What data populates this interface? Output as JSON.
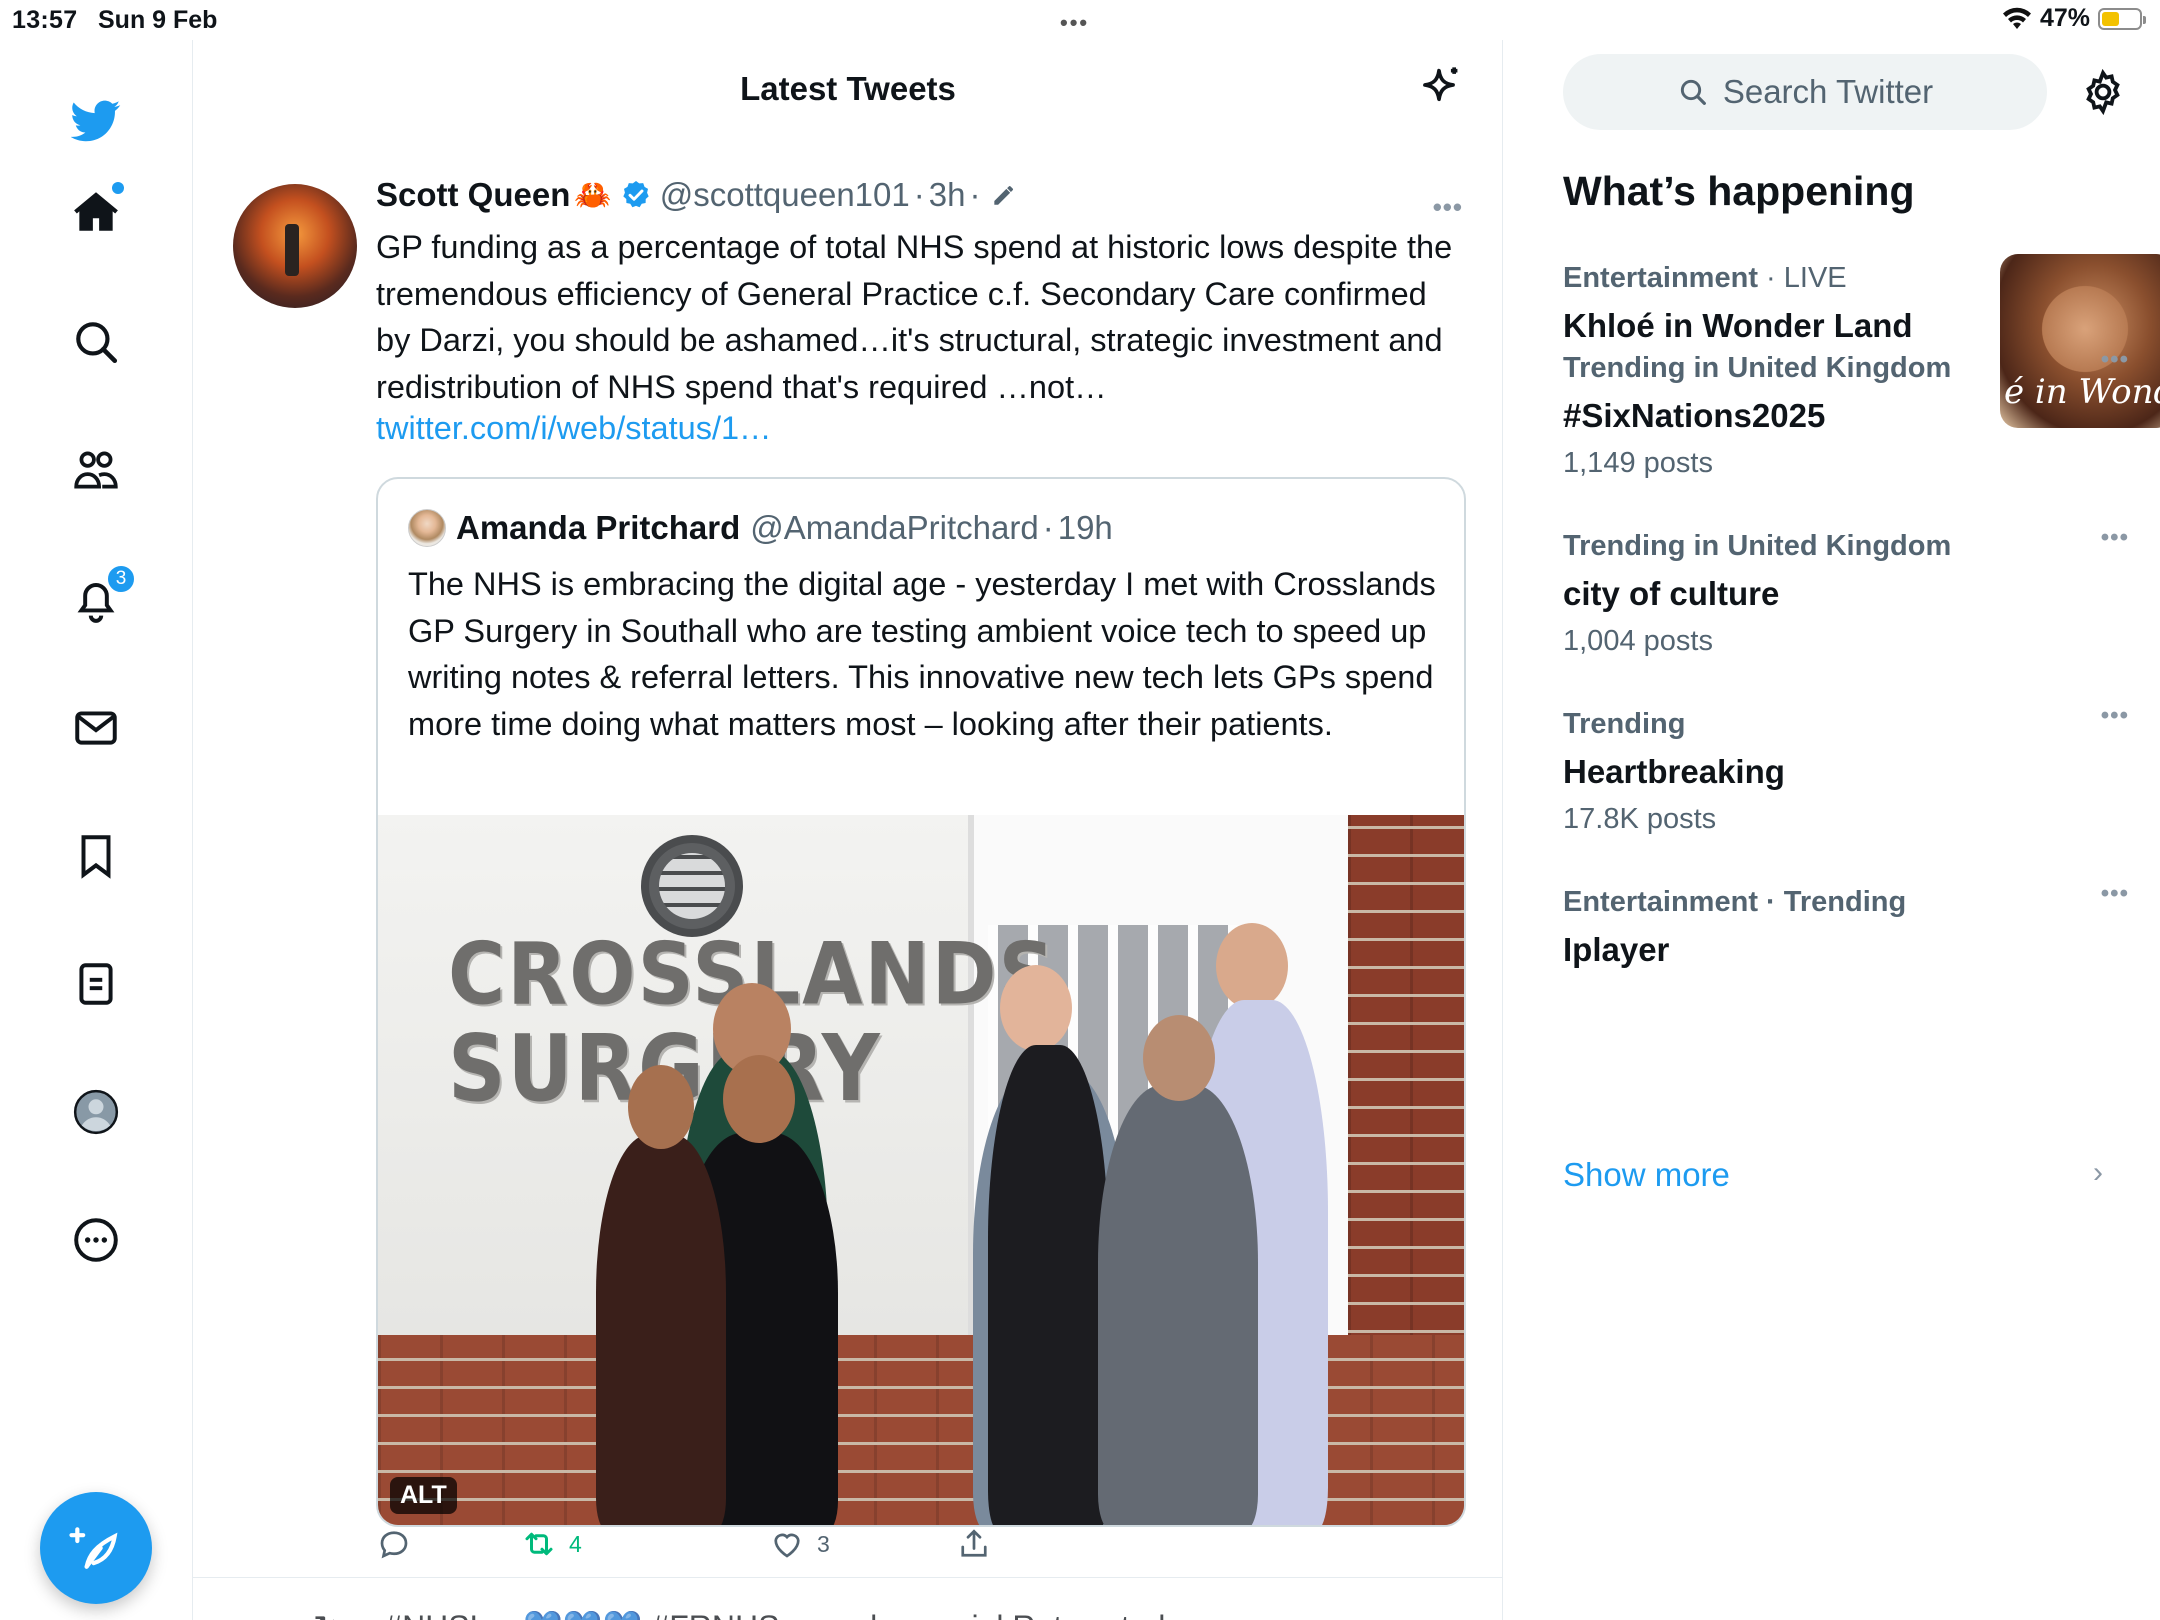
{
  "status_bar": {
    "time": "13:57",
    "date": "Sun 9 Feb",
    "battery": "47%",
    "battery_level": 0.47
  },
  "nav": {
    "notifications_badge": "3"
  },
  "header": {
    "title": "Latest Tweets"
  },
  "tweet": {
    "author_name": "Scott Queen",
    "author_emoji": "🦀",
    "handle": "@scottqueen101",
    "sep1": "·",
    "time": "3h",
    "sep2": "·",
    "text": "GP funding as a percentage of total NHS spend at historic lows despite the tremendous efficiency of General Practice c.f. Secondary Care confirmed by Darzi, you should be ashamed…it's structural, strategic investment and redistribution of NHS spend that's required …not…",
    "link": "twitter.com/i/web/status/1…",
    "quote": {
      "author_name": "Amanda Pritchard",
      "handle": "@AmandaPritchard",
      "sep": "·",
      "time": "19h",
      "text": "The NHS is embracing the digital age - yesterday I met with Crosslands GP Surgery in Southall who are testing ambient voice tech to speed up writing notes & referral letters. This innovative new tech lets GPs spend more time doing what matters most – looking after their patients.",
      "photo_sign_line1": "CROSSLANDS",
      "photo_sign_line2": "SURGERY",
      "alt_label": "ALT"
    },
    "actions": {
      "replies": "",
      "retweets": "4",
      "likes": "3"
    }
  },
  "next_tweet_peek": "↻ ... #NHSL... 💙💙💙 #FRNHS ... and ... social Retweeted",
  "sidebar": {
    "search_placeholder": "Search Twitter",
    "section_title": "What’s happening",
    "featured": {
      "category": "Entertainment",
      "sep": "·",
      "status": "LIVE",
      "name": "Khloé in Wonder Land",
      "thumb_text": "é in Wonder l"
    },
    "trends": [
      {
        "category": "Trending in United Kingdom",
        "name": "#SixNations2025",
        "count": "1,149 posts"
      },
      {
        "category": "Trending in United Kingdom",
        "name": "city of culture",
        "count": "1,004 posts"
      },
      {
        "category": "Trending",
        "name": "Heartbreaking",
        "count": "17.8K posts"
      },
      {
        "category": "Entertainment · Trending",
        "name": "Iplayer",
        "count": ""
      }
    ],
    "show_more": "Show more"
  },
  "colors": {
    "accent": "#1d9bf0",
    "retweet_green": "#00ba7c",
    "muted": "#536471",
    "battery_yellow": "#f3c200"
  }
}
